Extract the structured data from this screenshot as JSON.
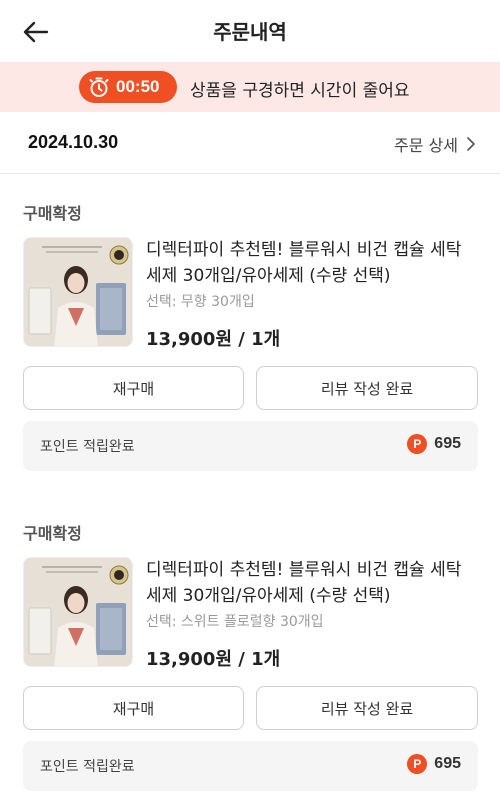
{
  "header": {
    "title": "주문내역",
    "back_icon": "back-arrow-icon"
  },
  "timer_banner": {
    "time": "00:50",
    "message": "상품을 구경하면 시간이 줄어요",
    "icon": "stopwatch-icon"
  },
  "order": {
    "date": "2024.10.30",
    "detail_link": "주문 상세"
  },
  "items": [
    {
      "status": "구매확정",
      "name_line1": "디렉터파이 추천템! 블루워시 비건 캡슐 세탁",
      "name_line2": "세제 30개입/유아세제 (수량 선택)",
      "option": "선택: 무향 30개입",
      "price": "13,900원 / 1개",
      "rebuy_label": "재구매",
      "review_label": "리뷰 작성 완료",
      "points_label": "포인트 적립완료",
      "points_badge": "P",
      "points_value": "695"
    },
    {
      "status": "구매확정",
      "name_line1": "디렉터파이 추천템! 블루워시 비건 캡슐 세탁",
      "name_line2": "세제 30개입/유아세제 (수량 선택)",
      "option": "선택: 스위트 플로럴향 30개입",
      "price": "13,900원 / 1개",
      "rebuy_label": "재구매",
      "review_label": "리뷰 작성 완료",
      "points_label": "포인트 적립완료",
      "points_badge": "P",
      "points_value": "695"
    }
  ],
  "colors": {
    "accent": "#f04e23",
    "banner_bg": "#fde8e6",
    "points_bg": "#f5f5f5"
  }
}
